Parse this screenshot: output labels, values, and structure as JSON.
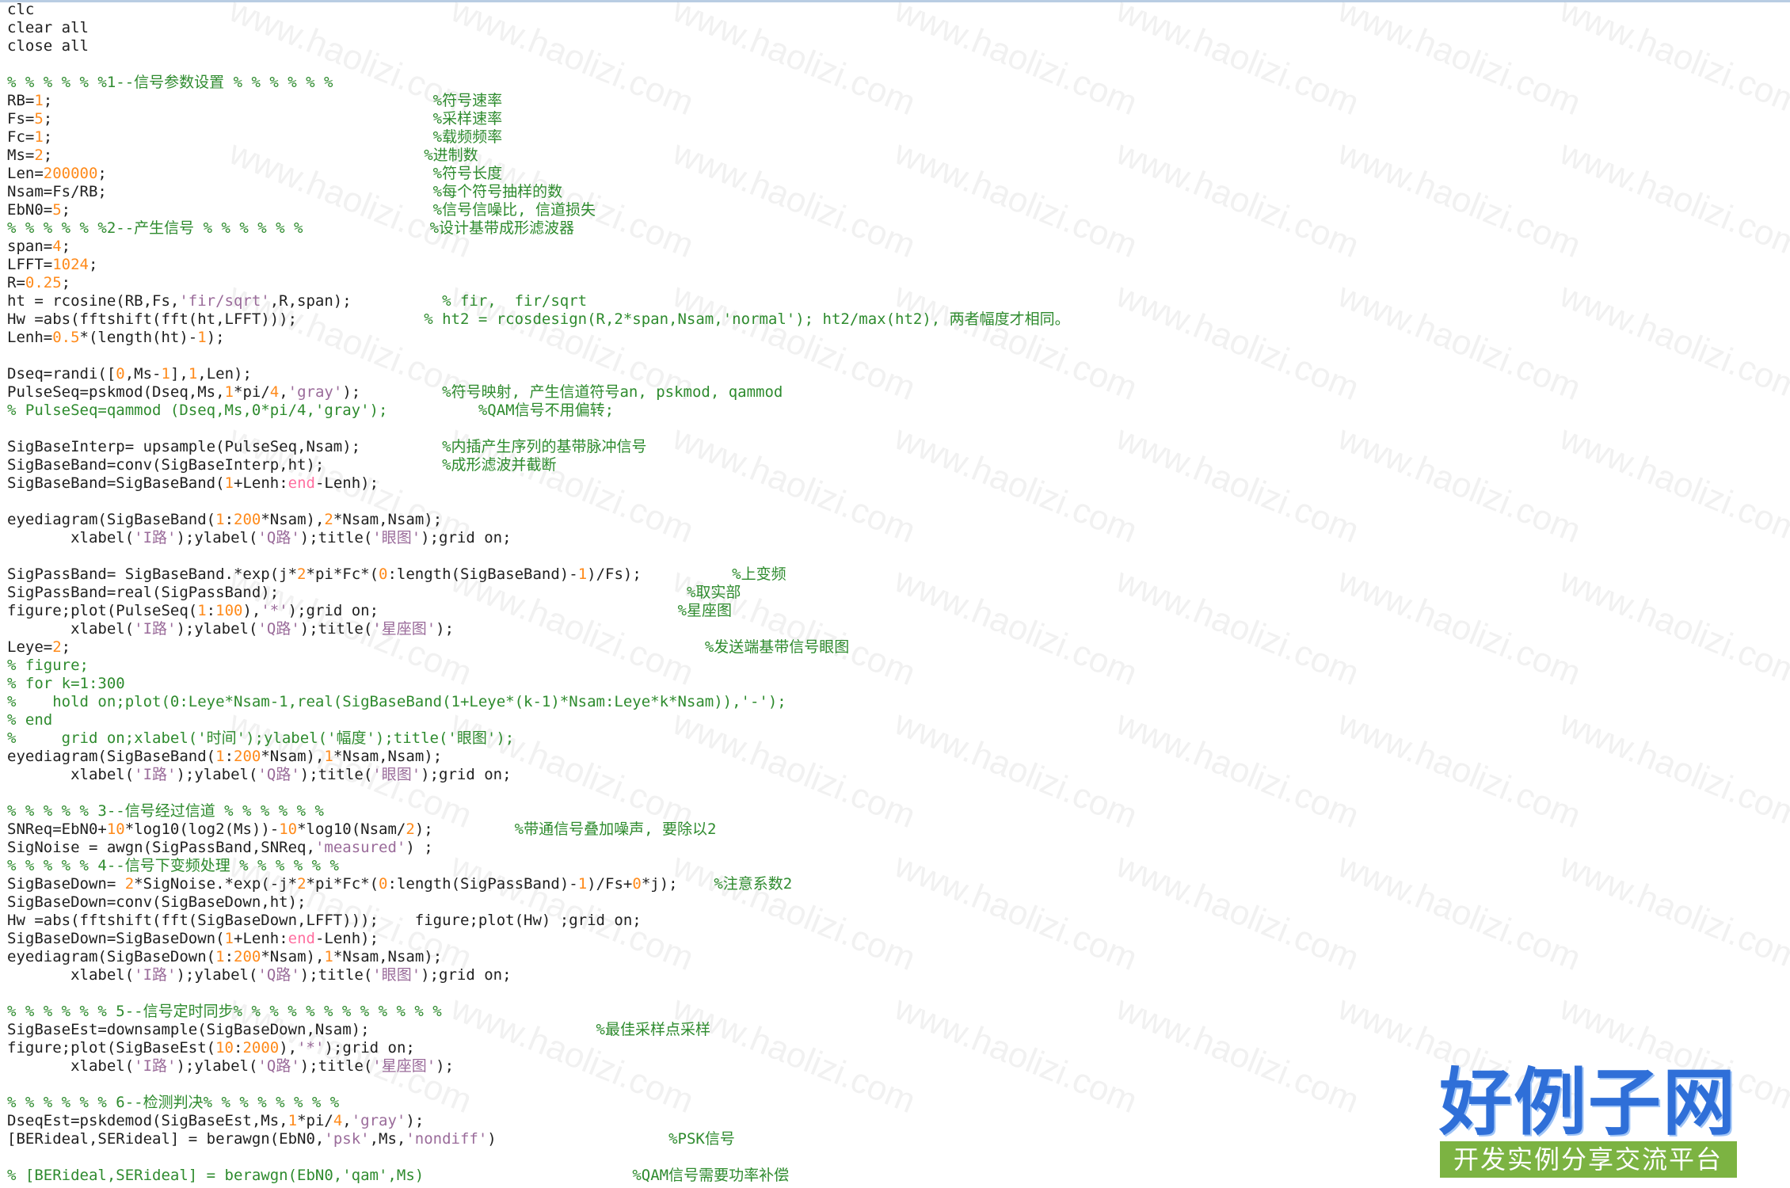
{
  "editor": {
    "lines": [
      [
        [
          "t",
          "clc"
        ]
      ],
      [
        [
          "t",
          "clear all"
        ]
      ],
      [
        [
          "t",
          "close all"
        ]
      ],
      [],
      [
        [
          "c",
          "% % % % % %1--信号参数设置 % % % % % %"
        ]
      ],
      [
        [
          "t",
          "RB="
        ],
        [
          "n",
          "1"
        ],
        [
          "t",
          ";"
        ],
        [
          "s2",
          "                                          "
        ],
        [
          "c",
          "%符号速率"
        ]
      ],
      [
        [
          "t",
          "Fs="
        ],
        [
          "n",
          "5"
        ],
        [
          "t",
          ";"
        ],
        [
          "s2",
          "                                          "
        ],
        [
          "c",
          "%采样速率"
        ]
      ],
      [
        [
          "t",
          "Fc="
        ],
        [
          "n",
          "1"
        ],
        [
          "t",
          ";"
        ],
        [
          "s2",
          "                                          "
        ],
        [
          "c",
          "%载频频率"
        ]
      ],
      [
        [
          "t",
          "Ms="
        ],
        [
          "n",
          "2"
        ],
        [
          "t",
          ";"
        ],
        [
          "s2",
          "                                         "
        ],
        [
          "c",
          "%进制数"
        ]
      ],
      [
        [
          "t",
          "Len="
        ],
        [
          "n",
          "200000"
        ],
        [
          "t",
          ";"
        ],
        [
          "s2",
          "                                    "
        ],
        [
          "c",
          "%符号长度"
        ]
      ],
      [
        [
          "t",
          "Nsam=Fs/RB;"
        ],
        [
          "s2",
          "                                    "
        ],
        [
          "c",
          "%每个符号抽样的数"
        ]
      ],
      [
        [
          "t",
          "EbN0="
        ],
        [
          "n",
          "5"
        ],
        [
          "t",
          ";"
        ],
        [
          "s2",
          "                                        "
        ],
        [
          "c",
          "%信号信噪比, 信道损失"
        ]
      ],
      [
        [
          "c",
          "% % % % % %2--产生信号 % % % % % %"
        ],
        [
          "s2",
          "              "
        ],
        [
          "c",
          "%设计基带成形滤波器"
        ]
      ],
      [
        [
          "t",
          "span="
        ],
        [
          "n",
          "4"
        ],
        [
          "t",
          ";"
        ]
      ],
      [
        [
          "t",
          "LFFT="
        ],
        [
          "n",
          "1024"
        ],
        [
          "t",
          ";"
        ]
      ],
      [
        [
          "t",
          "R="
        ],
        [
          "n",
          "0.25"
        ],
        [
          "t",
          ";"
        ]
      ],
      [
        [
          "t",
          "ht = rcosine(RB,Fs,"
        ],
        [
          "s",
          "'fir/sqrt'"
        ],
        [
          "t",
          ",R,span);"
        ],
        [
          "s2",
          "          "
        ],
        [
          "c",
          "% fir,  fir/sqrt"
        ]
      ],
      [
        [
          "t",
          "Hw =abs(fftshift(fft(ht,LFFT)));"
        ],
        [
          "s2",
          "              "
        ],
        [
          "c",
          "% ht2 = rcosdesign(R,2*span,Nsam,'normal'); ht2/max(ht2), 两者幅度才相同。"
        ]
      ],
      [
        [
          "t",
          "Lenh="
        ],
        [
          "n",
          "0.5"
        ],
        [
          "t",
          "*(length(ht)-"
        ],
        [
          "n",
          "1"
        ],
        [
          "t",
          ");"
        ]
      ],
      [],
      [
        [
          "t",
          "Dseq=randi(["
        ],
        [
          "n",
          "0"
        ],
        [
          "t",
          ",Ms-"
        ],
        [
          "n",
          "1"
        ],
        [
          "t",
          "],"
        ],
        [
          "n",
          "1"
        ],
        [
          "t",
          ",Len);"
        ]
      ],
      [
        [
          "t",
          "PulseSeq=pskmod(Dseq,Ms,"
        ],
        [
          "n",
          "1"
        ],
        [
          "t",
          "*pi/"
        ],
        [
          "n",
          "4"
        ],
        [
          "t",
          ","
        ],
        [
          "s",
          "'gray'"
        ],
        [
          "t",
          ");"
        ],
        [
          "s2",
          "         "
        ],
        [
          "c",
          "%符号映射, 产生信道符号an, pskmod, qammod"
        ]
      ],
      [
        [
          "c",
          "% PulseSeq=qammod (Dseq,Ms,0*pi/4,'gray');"
        ],
        [
          "s2",
          "          "
        ],
        [
          "c",
          "%QAM信号不用偏转;"
        ]
      ],
      [],
      [
        [
          "t",
          "SigBaseInterp= upsample(PulseSeq,Nsam);"
        ],
        [
          "s2",
          "         "
        ],
        [
          "c",
          "%内插产生序列的基带脉冲信号"
        ]
      ],
      [
        [
          "t",
          "SigBaseBand=conv(SigBaseInterp,ht);"
        ],
        [
          "s2",
          "             "
        ],
        [
          "c",
          "%成形滤波并截断"
        ]
      ],
      [
        [
          "t",
          "SigBaseBand=SigBaseBand("
        ],
        [
          "n",
          "1"
        ],
        [
          "t",
          "+Lenh:"
        ],
        [
          "k",
          "end"
        ],
        [
          "t",
          "-Lenh);"
        ]
      ],
      [],
      [
        [
          "t",
          "eyediagram(SigBaseBand("
        ],
        [
          "n",
          "1"
        ],
        [
          "t",
          ":"
        ],
        [
          "n",
          "200"
        ],
        [
          "t",
          "*Nsam),"
        ],
        [
          "n",
          "2"
        ],
        [
          "t",
          "*Nsam,Nsam);"
        ]
      ],
      [
        [
          "t",
          "       xlabel("
        ],
        [
          "s",
          "'I路'"
        ],
        [
          "t",
          ");ylabel("
        ],
        [
          "s",
          "'Q路'"
        ],
        [
          "t",
          ");title("
        ],
        [
          "s",
          "'眼图'"
        ],
        [
          "t",
          ");grid on;"
        ]
      ],
      [],
      [
        [
          "t",
          "SigPassBand= SigBaseBand.*exp(j*"
        ],
        [
          "n",
          "2"
        ],
        [
          "t",
          "*pi*Fc*("
        ],
        [
          "n",
          "0"
        ],
        [
          "t",
          ":length(SigBaseBand)-"
        ],
        [
          "n",
          "1"
        ],
        [
          "t",
          ")/Fs);"
        ],
        [
          "s2",
          "          "
        ],
        [
          "c",
          "%上变频"
        ]
      ],
      [
        [
          "t",
          "SigPassBand=real(SigPassBand);"
        ],
        [
          "s2",
          "                                             "
        ],
        [
          "c",
          "%取实部"
        ]
      ],
      [
        [
          "t",
          "figure;plot(PulseSeq("
        ],
        [
          "n",
          "1"
        ],
        [
          "t",
          ":"
        ],
        [
          "n",
          "100"
        ],
        [
          "t",
          "),"
        ],
        [
          "s",
          "'*'"
        ],
        [
          "t",
          ");grid on;"
        ],
        [
          "s2",
          "                                 "
        ],
        [
          "c",
          "%星座图"
        ]
      ],
      [
        [
          "t",
          "       xlabel("
        ],
        [
          "s",
          "'I路'"
        ],
        [
          "t",
          ");ylabel("
        ],
        [
          "s",
          "'Q路'"
        ],
        [
          "t",
          ");title("
        ],
        [
          "s",
          "'星座图'"
        ],
        [
          "t",
          ");"
        ]
      ],
      [
        [
          "t",
          "Leye="
        ],
        [
          "n",
          "2"
        ],
        [
          "t",
          ";"
        ],
        [
          "s2",
          "                                                                      "
        ],
        [
          "c",
          "%发送端基带信号眼图"
        ]
      ],
      [
        [
          "c",
          "% figure;"
        ]
      ],
      [
        [
          "c",
          "% for k=1:300"
        ]
      ],
      [
        [
          "c",
          "%    hold on;plot(0:Leye*Nsam-1,real(SigBaseBand(1+Leye*(k-1)*Nsam:Leye*k*Nsam)),'-');"
        ]
      ],
      [
        [
          "c",
          "% end"
        ]
      ],
      [
        [
          "c",
          "%     grid on;xlabel('时间');ylabel('幅度');title('眼图');"
        ]
      ],
      [
        [
          "t",
          "eyediagram(SigBaseBand("
        ],
        [
          "n",
          "1"
        ],
        [
          "t",
          ":"
        ],
        [
          "n",
          "200"
        ],
        [
          "t",
          "*Nsam),"
        ],
        [
          "n",
          "1"
        ],
        [
          "t",
          "*Nsam,Nsam);"
        ]
      ],
      [
        [
          "t",
          "       xlabel("
        ],
        [
          "s",
          "'I路'"
        ],
        [
          "t",
          ");ylabel("
        ],
        [
          "s",
          "'Q路'"
        ],
        [
          "t",
          ");title("
        ],
        [
          "s",
          "'眼图'"
        ],
        [
          "t",
          ");grid on;"
        ]
      ],
      [],
      [
        [
          "c",
          "% % % % % 3--信号经过信道 % % % % % %"
        ]
      ],
      [
        [
          "t",
          "SNReq=EbN0+"
        ],
        [
          "n",
          "10"
        ],
        [
          "t",
          "*log10(log2(Ms))-"
        ],
        [
          "n",
          "10"
        ],
        [
          "t",
          "*log10(Nsam/"
        ],
        [
          "n",
          "2"
        ],
        [
          "t",
          ");"
        ],
        [
          "s2",
          "         "
        ],
        [
          "c",
          "%带通信号叠加噪声, 要除以2"
        ]
      ],
      [
        [
          "t",
          "SigNoise = awgn(SigPassBand,SNReq,"
        ],
        [
          "s",
          "'measured'"
        ],
        [
          "t",
          ") ;"
        ]
      ],
      [
        [
          "c",
          "% % % % % 4--信号下变频处理 % % % % % %"
        ]
      ],
      [
        [
          "t",
          "SigBaseDown= "
        ],
        [
          "n",
          "2"
        ],
        [
          "t",
          "*SigNoise.*exp(-j*"
        ],
        [
          "n",
          "2"
        ],
        [
          "t",
          "*pi*Fc*("
        ],
        [
          "n",
          "0"
        ],
        [
          "t",
          ":length(SigPassBand)-"
        ],
        [
          "n",
          "1"
        ],
        [
          "t",
          ")/Fs+"
        ],
        [
          "n",
          "0"
        ],
        [
          "t",
          "*j);"
        ],
        [
          "s2",
          "    "
        ],
        [
          "c",
          "%注意系数2"
        ]
      ],
      [
        [
          "t",
          "SigBaseDown=conv(SigBaseDown,ht);"
        ]
      ],
      [
        [
          "t",
          "Hw =abs(fftshift(fft(SigBaseDown,LFFT)));    figure;plot(Hw) ;grid on;"
        ]
      ],
      [
        [
          "t",
          "SigBaseDown=SigBaseDown("
        ],
        [
          "n",
          "1"
        ],
        [
          "t",
          "+Lenh:"
        ],
        [
          "k",
          "end"
        ],
        [
          "t",
          "-Lenh);"
        ]
      ],
      [
        [
          "t",
          "eyediagram(SigBaseDown("
        ],
        [
          "n",
          "1"
        ],
        [
          "t",
          ":"
        ],
        [
          "n",
          "200"
        ],
        [
          "t",
          "*Nsam),"
        ],
        [
          "n",
          "1"
        ],
        [
          "t",
          "*Nsam,Nsam);"
        ]
      ],
      [
        [
          "t",
          "       xlabel("
        ],
        [
          "s",
          "'I路'"
        ],
        [
          "t",
          ");ylabel("
        ],
        [
          "s",
          "'Q路'"
        ],
        [
          "t",
          ");title("
        ],
        [
          "s",
          "'眼图'"
        ],
        [
          "t",
          ");grid on;"
        ]
      ],
      [],
      [
        [
          "c",
          "% % % % % % 5--信号定时同步% % % % % % % % % % % %"
        ]
      ],
      [
        [
          "t",
          "SigBaseEst=downsample(SigBaseDown,Nsam);"
        ],
        [
          "s2",
          "                         "
        ],
        [
          "c",
          "%最佳采样点采样"
        ]
      ],
      [
        [
          "t",
          "figure;plot(SigBaseEst("
        ],
        [
          "n",
          "10"
        ],
        [
          "t",
          ":"
        ],
        [
          "n",
          "2000"
        ],
        [
          "t",
          "),"
        ],
        [
          "s",
          "'*'"
        ],
        [
          "t",
          ");grid on;"
        ]
      ],
      [
        [
          "t",
          "       xlabel("
        ],
        [
          "s",
          "'I路'"
        ],
        [
          "t",
          ");ylabel("
        ],
        [
          "s",
          "'Q路'"
        ],
        [
          "t",
          ");title("
        ],
        [
          "s",
          "'星座图'"
        ],
        [
          "t",
          ");"
        ]
      ],
      [],
      [
        [
          "c",
          "% % % % % % 6--检测判决% % % % % % % %"
        ]
      ],
      [
        [
          "t",
          "DseqEst=pskdemod(SigBaseEst,Ms,"
        ],
        [
          "n",
          "1"
        ],
        [
          "t",
          "*pi/"
        ],
        [
          "n",
          "4"
        ],
        [
          "t",
          ","
        ],
        [
          "s",
          "'gray'"
        ],
        [
          "t",
          ");"
        ]
      ],
      [
        [
          "t",
          "[BERideal,SERideal] = berawgn(EbN0,"
        ],
        [
          "s",
          "'psk'"
        ],
        [
          "t",
          ",Ms,"
        ],
        [
          "s",
          "'nondiff'"
        ],
        [
          "t",
          ")"
        ],
        [
          "s2",
          "                   "
        ],
        [
          "c",
          "%PSK信号"
        ]
      ],
      [],
      [
        [
          "c",
          "% [BERideal,SERideal] = berawgn(EbN0,'qam',Ms)"
        ],
        [
          "s2",
          "                       "
        ],
        [
          "c",
          "%QAM信号需要功率补偿"
        ]
      ]
    ]
  },
  "watermark": {
    "text": "www.haolizi.com"
  },
  "logo": {
    "title": "好例子网",
    "subtitle": "开发实例分享交流平台"
  }
}
